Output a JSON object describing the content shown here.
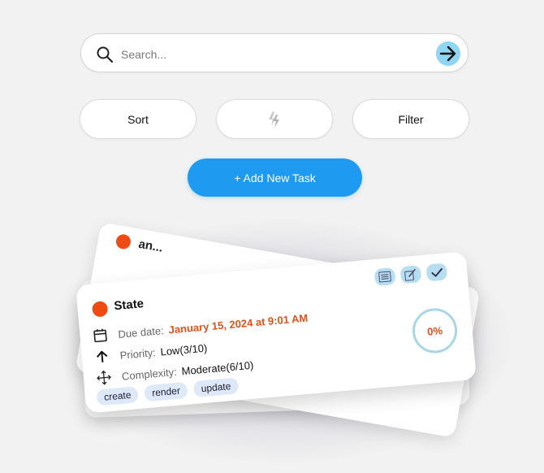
{
  "search": {
    "placeholder": "Search...",
    "value": ""
  },
  "toolbar": {
    "sort_label": "Sort",
    "filter_label": "Filter",
    "middle_icon": "lightning-icon"
  },
  "add_task": {
    "label": "+ Add New Task"
  },
  "back_card": {
    "title": "an..."
  },
  "card": {
    "title": "State",
    "due_label": "Due date:",
    "due_value": "January 15, 2024 at 9:01 AM",
    "priority_label": "Priority:",
    "priority_value": "Low(3/10)",
    "complexity_label": "Complexity:",
    "complexity_value": "Moderate(6/10)",
    "tags": [
      "create",
      "render",
      "update"
    ],
    "progress": "0%",
    "progress_fraction": 0
  },
  "colors": {
    "accent": "#1e9bf0",
    "status": "#ee4b12",
    "action_bg": "#b7def0",
    "go_bg": "#8fd6f5"
  }
}
